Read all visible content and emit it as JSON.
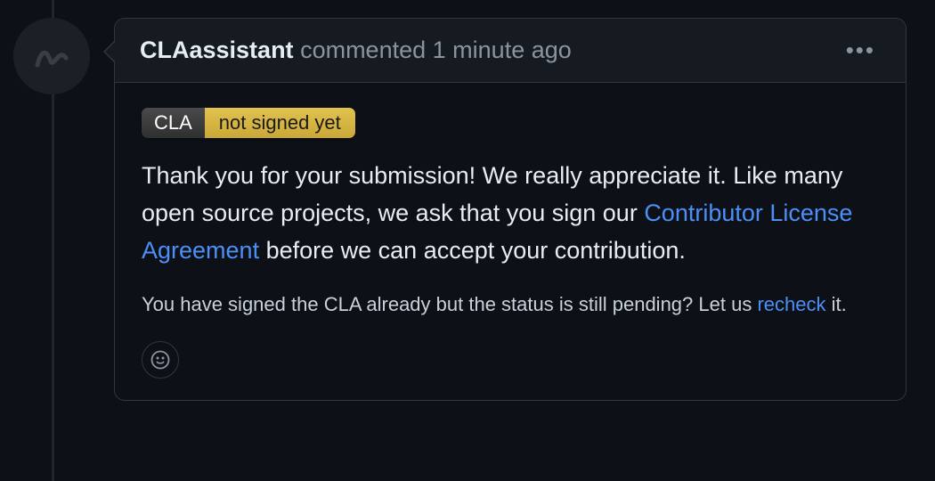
{
  "comment": {
    "author": "CLAassistant",
    "action": "commented",
    "timestamp": "1 minute ago",
    "badge": {
      "left": "CLA",
      "right": "not signed yet"
    },
    "body": {
      "p1a": "Thank you for your submission! We really appreciate it. Like many open source projects, we ask that you sign our ",
      "p1_link": "Contributor License Agreement",
      "p1b": " before we can accept your contribution.",
      "p2a": "You have signed the CLA already but the status is still pending? Let us ",
      "p2_link": "recheck",
      "p2b": " it."
    }
  }
}
